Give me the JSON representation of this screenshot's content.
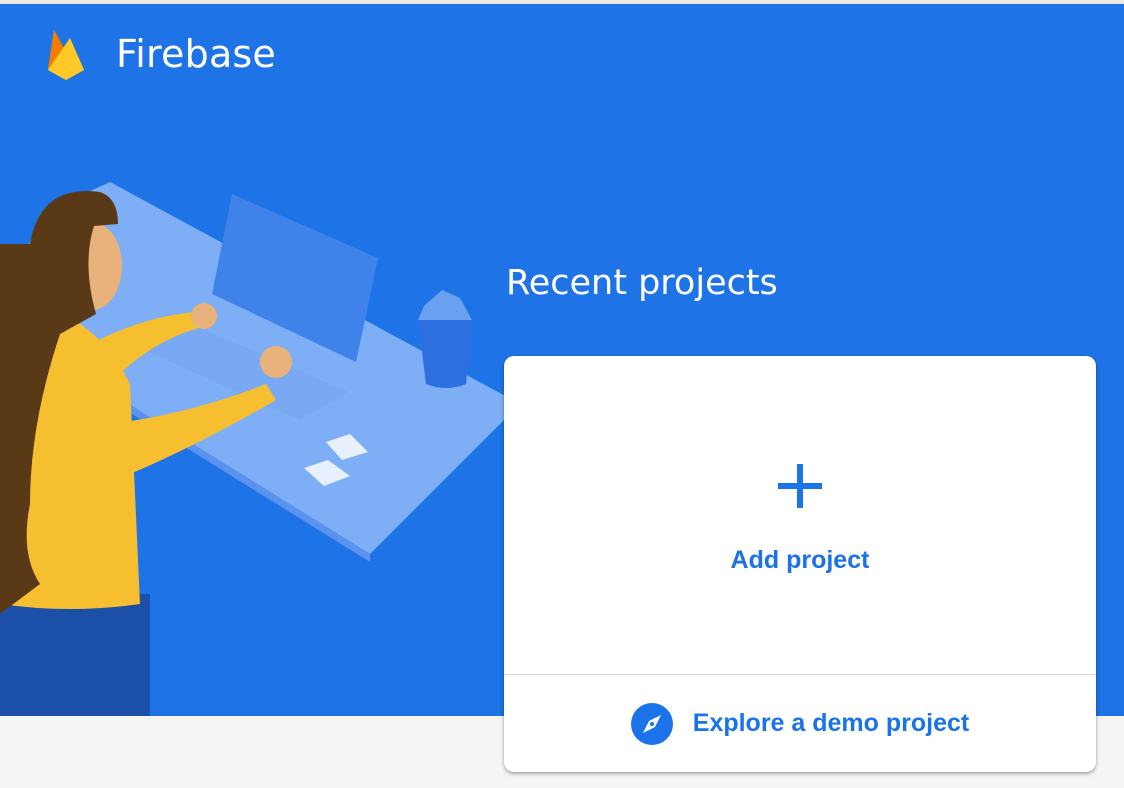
{
  "app": {
    "brand_name": "Firebase",
    "logo_icon": "firebase-flame-icon"
  },
  "main": {
    "section_title": "Recent projects",
    "add_project": {
      "icon": "plus-icon",
      "label": "Add project"
    },
    "demo_project": {
      "icon": "compass-icon",
      "label": "Explore a demo project"
    }
  },
  "colors": {
    "hero_background": "#1e73e6",
    "accent": "#1a73e8",
    "card_background": "#ffffff",
    "flame_yellow": "#ffca28",
    "flame_orange": "#ffa000"
  }
}
